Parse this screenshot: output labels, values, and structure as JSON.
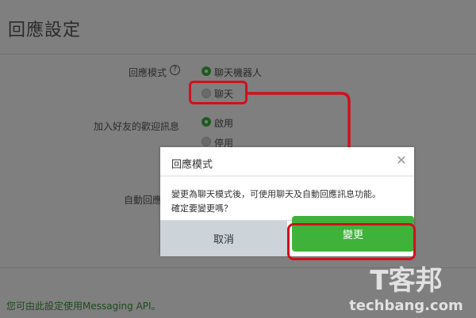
{
  "page": {
    "title": "回應設定",
    "response_mode_label": "回應模式",
    "response_mode_options": [
      "聊天機器人",
      "聊天"
    ],
    "welcome_label": "加入好友的歡迎訊息",
    "welcome_options": [
      "啟用",
      "停用"
    ],
    "auto_reply_label": "自動回應",
    "messaging_link": "您可由此設定使用Messaging API。"
  },
  "modal": {
    "title": "回應模式",
    "close_glyph": "✕",
    "body_line1": "變更為聊天模式後，可使用聊天及自動回應訊息功能。",
    "body_line2": "確定要變更嗎？",
    "cancel_label": "取消",
    "change_label": "變更"
  },
  "watermark": {
    "text_top": "T客邦",
    "text_bottom": "techbang.com"
  },
  "colors": {
    "accent_green": "#3fb23a",
    "annotation_red": "#d0101c",
    "radio_green": "#1f5a1f"
  }
}
